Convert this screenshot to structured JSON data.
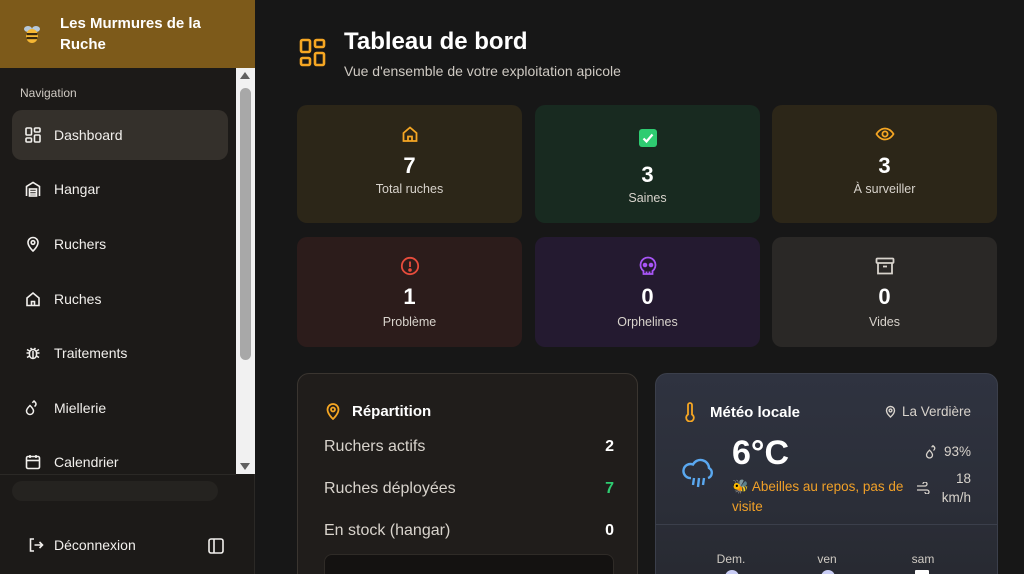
{
  "sidebar": {
    "brand": "Les Murmures de la Ruche",
    "nav_heading": "Navigation",
    "items": [
      {
        "label": "Dashboard"
      },
      {
        "label": "Hangar"
      },
      {
        "label": "Ruchers"
      },
      {
        "label": "Ruches"
      },
      {
        "label": "Traitements"
      },
      {
        "label": "Miellerie"
      },
      {
        "label": "Calendrier"
      }
    ],
    "logout": "Déconnexion"
  },
  "header": {
    "title": "Tableau de bord",
    "subtitle": "Vue d'ensemble de votre exploitation apicole"
  },
  "stats": [
    {
      "value": "7",
      "label": "Total ruches",
      "icon": "home-icon",
      "color": "#f5a623"
    },
    {
      "value": "3",
      "label": "Saines",
      "icon": "check-square-icon",
      "color": "#2ecc71"
    },
    {
      "value": "3",
      "label": "À surveiller",
      "icon": "eye-icon",
      "color": "#f5a623"
    },
    {
      "value": "1",
      "label": "Problème",
      "icon": "alert-circle-icon",
      "color": "#e74c3c"
    },
    {
      "value": "0",
      "label": "Orphelines",
      "icon": "skull-icon",
      "color": "#a855f7"
    },
    {
      "value": "0",
      "label": "Vides",
      "icon": "archive-icon",
      "color": "#d8d3cc"
    }
  ],
  "repartition": {
    "title": "Répartition",
    "rows": [
      {
        "label": "Ruchers actifs",
        "value": "2"
      },
      {
        "label": "Ruches déployées",
        "value": "7"
      },
      {
        "label": "En stock (hangar)",
        "value": "0"
      }
    ]
  },
  "meteo": {
    "title": "Météo locale",
    "location": "La Verdière",
    "temperature": "6°C",
    "status": "🐝 Abeilles au repos, pas de visite",
    "humidity": "93%",
    "wind_value": "18",
    "wind_unit": "km/h",
    "days": [
      "Dem.",
      "ven",
      "sam"
    ]
  },
  "colors": {
    "accent": "#f5a623",
    "brand_bg": "#7d5a1a",
    "healthy": "#2ecc71",
    "problem": "#e74c3c",
    "orphan": "#a855f7"
  }
}
